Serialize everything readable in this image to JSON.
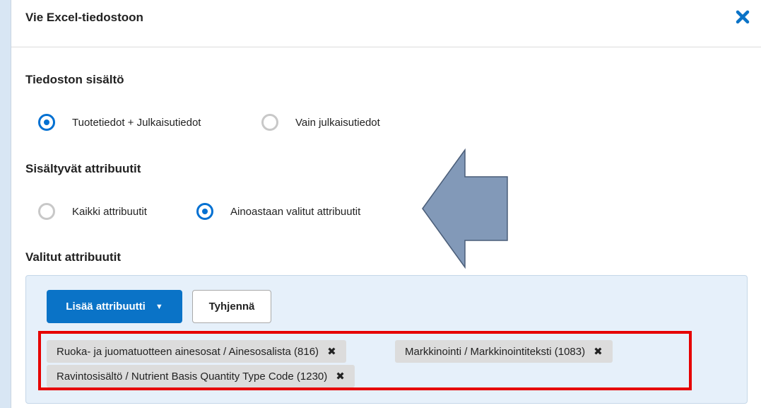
{
  "dialog": {
    "title": "Vie Excel-tiedostoon",
    "close_icon": "close-icon"
  },
  "content_section": {
    "label": "Tiedoston sisältö",
    "options": [
      {
        "label": "Tuotetiedot + Julkaisutiedot",
        "selected": true
      },
      {
        "label": "Vain julkaisutiedot",
        "selected": false
      }
    ]
  },
  "attributes_section": {
    "label": "Sisältyvät attribuutit",
    "options": [
      {
        "label": "Kaikki attribuutit",
        "selected": false
      },
      {
        "label": "Ainoastaan valitut attribuutit",
        "selected": true
      }
    ]
  },
  "selected_section": {
    "label": "Valitut attribuutit",
    "add_button": "Lisää attribuutti",
    "clear_button": "Tyhjennä",
    "tags": [
      {
        "label": "Ruoka- ja juomatuotteen ainesosat / Ainesosalista (816)"
      },
      {
        "label": "Markkinointi / Markkinointiteksti (1083)"
      },
      {
        "label": "Ravintosisältö / Nutrient Basis Quantity Type Code (1230)"
      }
    ]
  },
  "colors": {
    "accent": "#0070d2",
    "highlight": "#e60000",
    "arrow": "#8299b8"
  }
}
